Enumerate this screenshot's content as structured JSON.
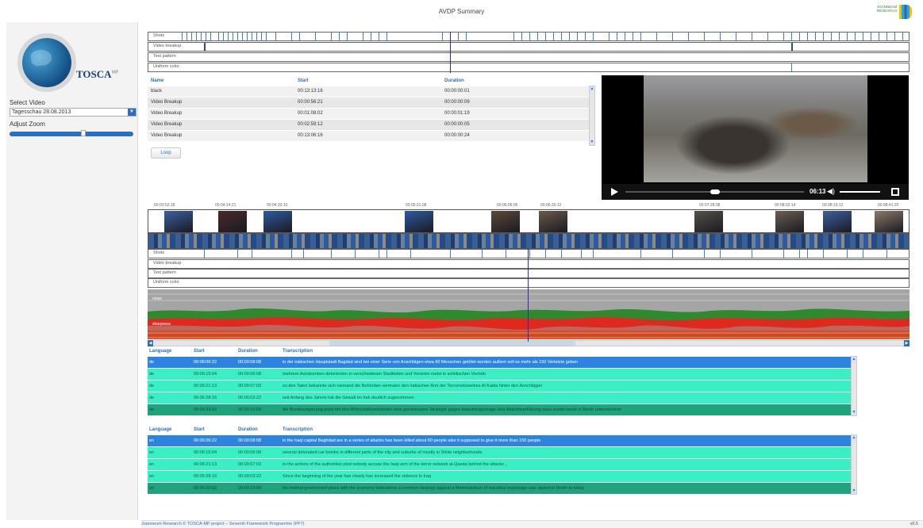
{
  "app": {
    "title": "AVDP Summary",
    "brand_name": "TOSCA",
    "brand_sup": "MP",
    "partner_logo": "JOANNEUM RESEARCH"
  },
  "sidebar": {
    "select_video_label": "Select Video",
    "selected_video": "Tagesschau 28.08.2013",
    "adjust_zoom_label": "Adjust Zoom",
    "zoom_level": 0.58
  },
  "overview_tracks": [
    "Shots",
    "Video breakup",
    "Test pattern",
    "Uniform color"
  ],
  "events": {
    "headers": [
      "Name",
      "Start",
      "Duration"
    ],
    "rows": [
      [
        "black",
        "00:13:13:16",
        "00:00:00:01"
      ],
      [
        "Video Breakup",
        "00:00:56:21",
        "00:00:00:09"
      ],
      [
        "Video Breakup",
        "00:01:08:02",
        "00:00:01:19"
      ],
      [
        "Video Breakup",
        "00:02:59:12",
        "00:00:00:05"
      ],
      [
        "Video Breakup",
        "00:13:06:16",
        "00:00:00:24"
      ]
    ],
    "loop_label": "Loop"
  },
  "player": {
    "time": "06:13",
    "progress": 0.5,
    "volume": 0.85
  },
  "timeline": {
    "stamps": [
      "00:03:52:18",
      "00:04:14:21",
      "00:04:33:10",
      "00:05:31:08",
      "00:06:06:06",
      "00:06:26:12",
      "00:07:28:08",
      "00:08:02:14",
      "00:08:19:12",
      "00:08:41:20"
    ],
    "tracks": [
      "Shots",
      "Video breakup",
      "Test pattern",
      "Uniform color"
    ],
    "graph_labels": [
      "noise",
      "sharpness"
    ]
  },
  "transcript_de": {
    "headers": [
      "Language",
      "Start",
      "Duration",
      "Transcription"
    ],
    "rows": [
      [
        "de",
        "00:06:06:22",
        "00:00:08:08",
        "in der irakischen Hauptstadt Bagdad sind bei einer Serie von Anschlägen etwa 60 Menschen getötet worden außem soll es mehr als 150 Verletzte geben"
      ],
      [
        "de",
        "00:06:15:04",
        "00:00:06:08",
        "mehrere Autobomben detonierten in verschiedenen Stadtteilen und Vororten meist in schiitischen Vierteln"
      ],
      [
        "de",
        "00:06:21:13",
        "00:00:07:03",
        "zu den Taten bekannte sich niemand die Behörden vermuten den irakischen Arm der Terrornetzwerkes Al Kaida hinter den Anschlägen"
      ],
      [
        "de",
        "00:06:28:16",
        "00:00:03:22",
        "seit Anfang des Jahres hat die Gewalt im Irak deutlich zugenommen"
      ],
      [
        "de",
        "00:06:33:02",
        "00:00:10:00",
        "die Bundesregierung plant mit den Wirtschaftsverbänden eine gemeinsame Strategie gegen Industriespionage eine Absichtserklärung dazu wurde heute in Berlin unterzeichnet"
      ]
    ]
  },
  "transcript_en": {
    "headers": [
      "Language",
      "Start",
      "Duration",
      "Transcription"
    ],
    "rows": [
      [
        "en",
        "00:06:06:22",
        "00:00:08:08",
        "in the Iraqi capital Baghdad are in a series of attacks has been killed about 60 people also it supposed to give it more than 150 people"
      ],
      [
        "en",
        "00:06:15:04",
        "00:00:06:08",
        "several detonated car bombs in different parts of the city and suburbs of mostly in Shiite neighborhoods"
      ],
      [
        "en",
        "00:06:21:13",
        "00:00:07:03",
        "to the actions of the authorities pled nobody accuse the Iraqi arm of the terror network al-Qaeda behind the attacks ,"
      ],
      [
        "en",
        "00:06:28:16",
        "00:00:03:22",
        "Since the beginning of the year has clearly has increased the violence in Iraq"
      ],
      [
        "en",
        "00:06:33:02",
        "00:00:10:00",
        "the federal government plans with the economy federations a common strategy against a Memorandum of industrial espionage was signed in Berlin to today"
      ]
    ]
  },
  "footer": {
    "text": "Joanneum Research © TOSCA-MP project – Seventh Framework Programme (FP7)",
    "version": "v0.5"
  }
}
